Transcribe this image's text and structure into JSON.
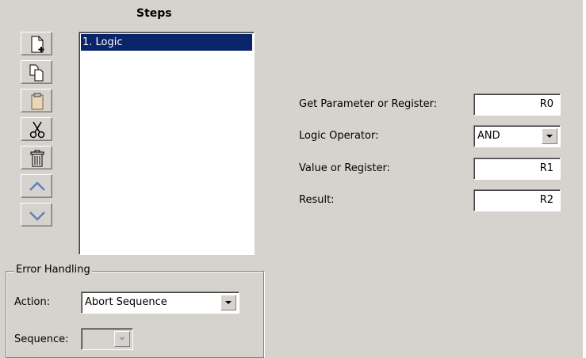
{
  "steps": {
    "title": "Steps",
    "items": [
      "1. Logic"
    ],
    "toolbar": [
      {
        "name": "new-step-icon"
      },
      {
        "name": "copy-icon"
      },
      {
        "name": "paste-icon"
      },
      {
        "name": "cut-icon"
      },
      {
        "name": "delete-icon"
      },
      {
        "name": "move-up-icon"
      },
      {
        "name": "move-down-icon"
      }
    ]
  },
  "error_handling": {
    "title": "Error Handling",
    "action_label": "Action:",
    "action_value": "Abort Sequence",
    "sequence_label": "Sequence:",
    "sequence_value": ""
  },
  "logic": {
    "get_param_label": "Get Parameter or Register:",
    "get_param_value": "R0",
    "operator_label": "Logic Operator:",
    "operator_value": "AND",
    "value_label": "Value or Register:",
    "value_value": "R1",
    "result_label": "Result:",
    "result_value": "R2"
  }
}
